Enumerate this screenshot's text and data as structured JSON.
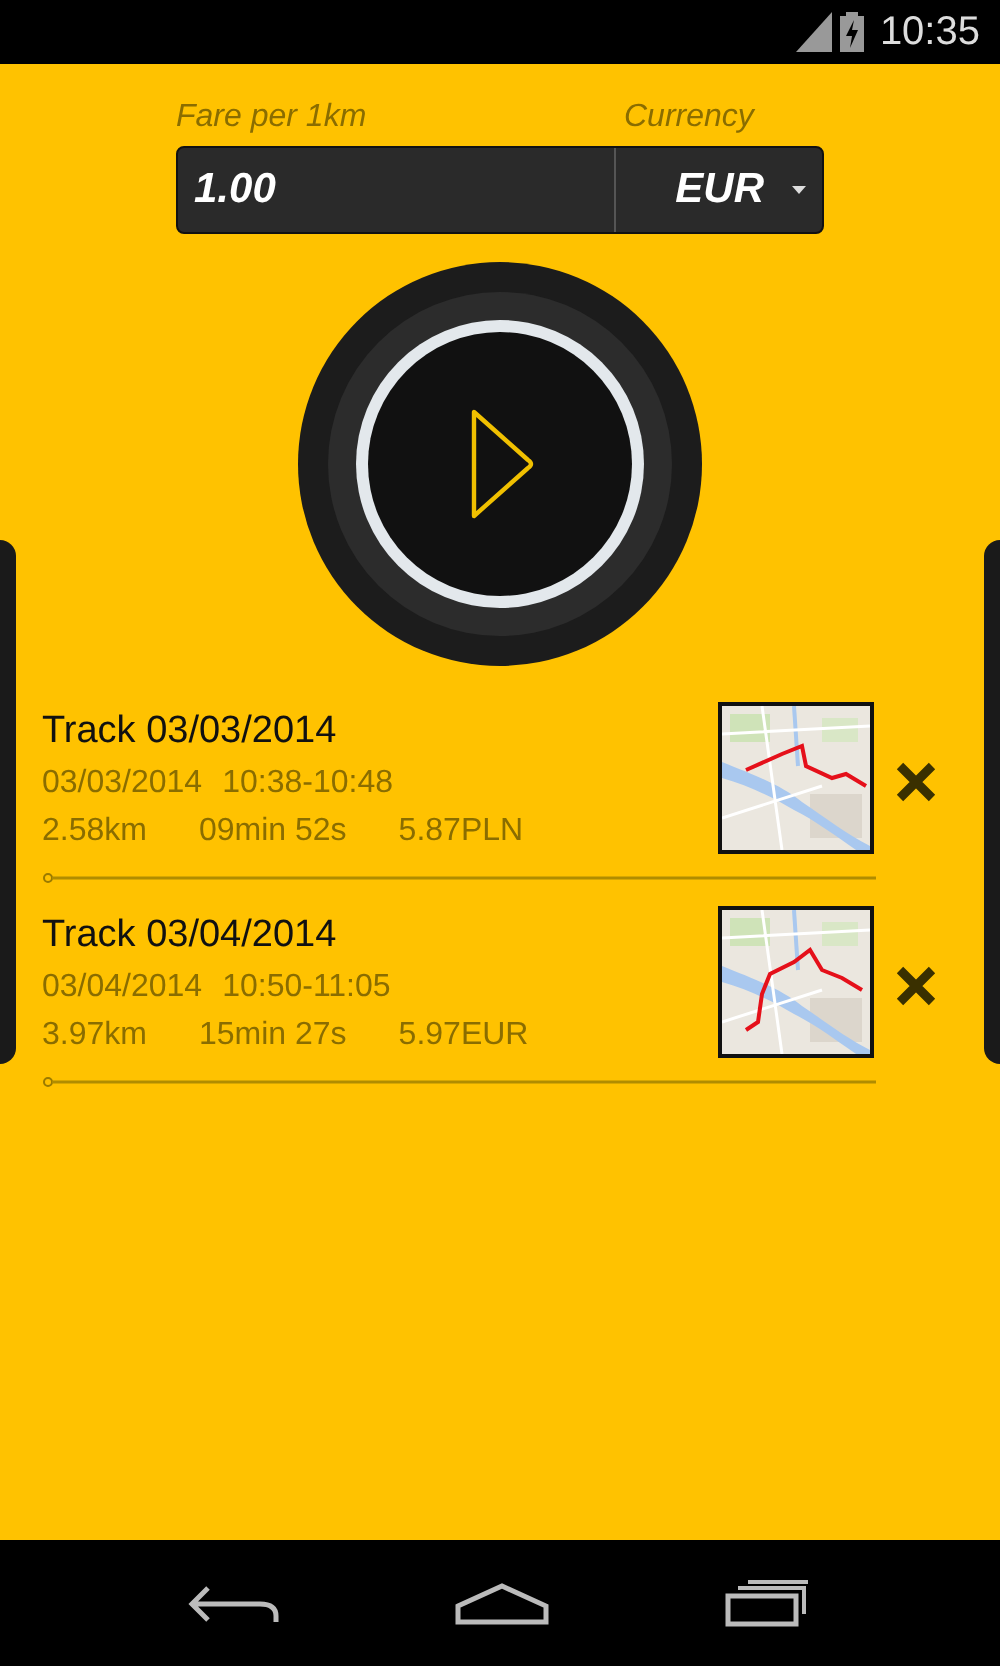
{
  "status_bar": {
    "time": "10:35"
  },
  "fare": {
    "label": "Fare per 1km",
    "value": "1.00"
  },
  "currency": {
    "label": "Currency",
    "value": "EUR"
  },
  "tracks": [
    {
      "title": "Track 03/03/2014",
      "date": "03/03/2014",
      "time_range": "10:38-10:48",
      "distance": "2.58km",
      "duration": "09min 52s",
      "cost": "5.87PLN"
    },
    {
      "title": "Track 03/04/2014",
      "date": "03/04/2014",
      "time_range": "10:50-11:05",
      "distance": "3.97km",
      "duration": "15min 27s",
      "cost": "5.97EUR"
    }
  ]
}
